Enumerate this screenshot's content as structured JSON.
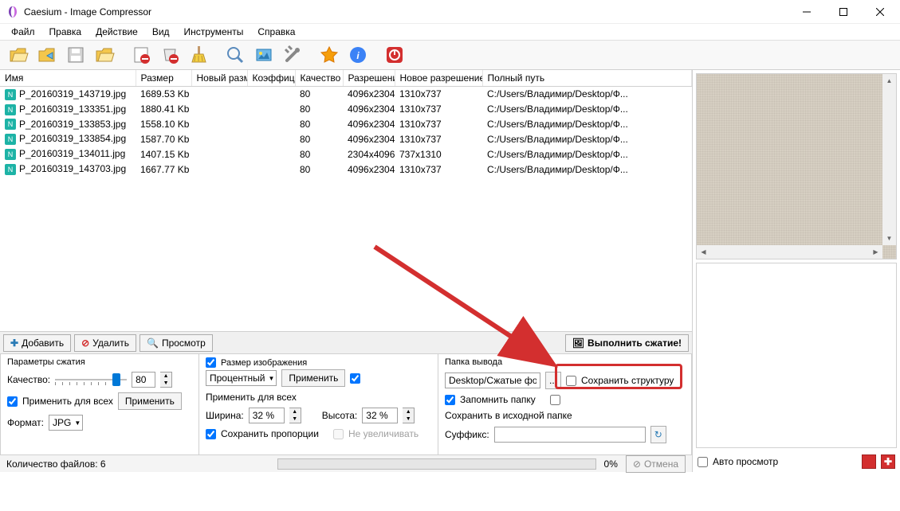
{
  "window": {
    "title": "Caesium - Image Compressor"
  },
  "menu": {
    "file": "Файл",
    "edit": "Правка",
    "action": "Действие",
    "view": "Вид",
    "tools": "Инструменты",
    "help": "Справка"
  },
  "columns": {
    "name": "Имя",
    "size": "Размер",
    "newsize": "Новый разм",
    "coef": "Коэффици",
    "quality": "Качество",
    "res": "Разрешение",
    "newres": "Новое разрешение",
    "path": "Полный путь"
  },
  "rows": [
    {
      "name": "P_20160319_143719.jpg",
      "size": "1689.53 Kb",
      "quality": "80",
      "res": "4096x2304",
      "newres": "1310x737",
      "path": "C:/Users/Владимир/Desktop/Ф..."
    },
    {
      "name": "P_20160319_133351.jpg",
      "size": "1880.41 Kb",
      "quality": "80",
      "res": "4096x2304",
      "newres": "1310x737",
      "path": "C:/Users/Владимир/Desktop/Ф..."
    },
    {
      "name": "P_20160319_133853.jpg",
      "size": "1558.10 Kb",
      "quality": "80",
      "res": "4096x2304",
      "newres": "1310x737",
      "path": "C:/Users/Владимир/Desktop/Ф..."
    },
    {
      "name": "P_20160319_133854.jpg",
      "size": "1587.70 Kb",
      "quality": "80",
      "res": "4096x2304",
      "newres": "1310x737",
      "path": "C:/Users/Владимир/Desktop/Ф..."
    },
    {
      "name": "P_20160319_134011.jpg",
      "size": "1407.15 Kb",
      "quality": "80",
      "res": "2304x4096",
      "newres": "737x1310",
      "path": "C:/Users/Владимир/Desktop/Ф..."
    },
    {
      "name": "P_20160319_143703.jpg",
      "size": "1667.77 Kb",
      "quality": "80",
      "res": "4096x2304",
      "newres": "1310x737",
      "path": "C:/Users/Владимир/Desktop/Ф..."
    }
  ],
  "buttons": {
    "add": "Добавить",
    "delete": "Удалить",
    "preview": "Просмотр",
    "compress": "Выполнить сжатие!",
    "apply": "Применить",
    "cancel": "Отмена",
    "browse": "..."
  },
  "compression": {
    "title": "Параметры сжатия",
    "quality_label": "Качество:",
    "quality_value": "80",
    "apply_all": "Применить для всех",
    "format_label": "Формат:",
    "format_value": "JPG"
  },
  "resize": {
    "title": "Размер изображения",
    "mode": "Процентный",
    "apply_all": "Применить для всех",
    "width_label": "Ширина:",
    "width_value": "32 %",
    "height_label": "Высота:",
    "height_value": "32 %",
    "keep_ratio": "Сохранить пропорции",
    "no_enlarge": "Не увеличивать"
  },
  "output": {
    "title": "Папка вывода",
    "path": "Desktop/Сжатые фото",
    "keep_structure": "Сохранить структуру",
    "remember": "Запомнить папку",
    "save_source": "Сохранить в исходной папке",
    "suffix_label": "Суффикс:",
    "suffix_value": ""
  },
  "status": {
    "count": "Количество файлов: 6",
    "progress": "0%"
  },
  "preview_panel": {
    "auto": "Авто просмотр"
  }
}
